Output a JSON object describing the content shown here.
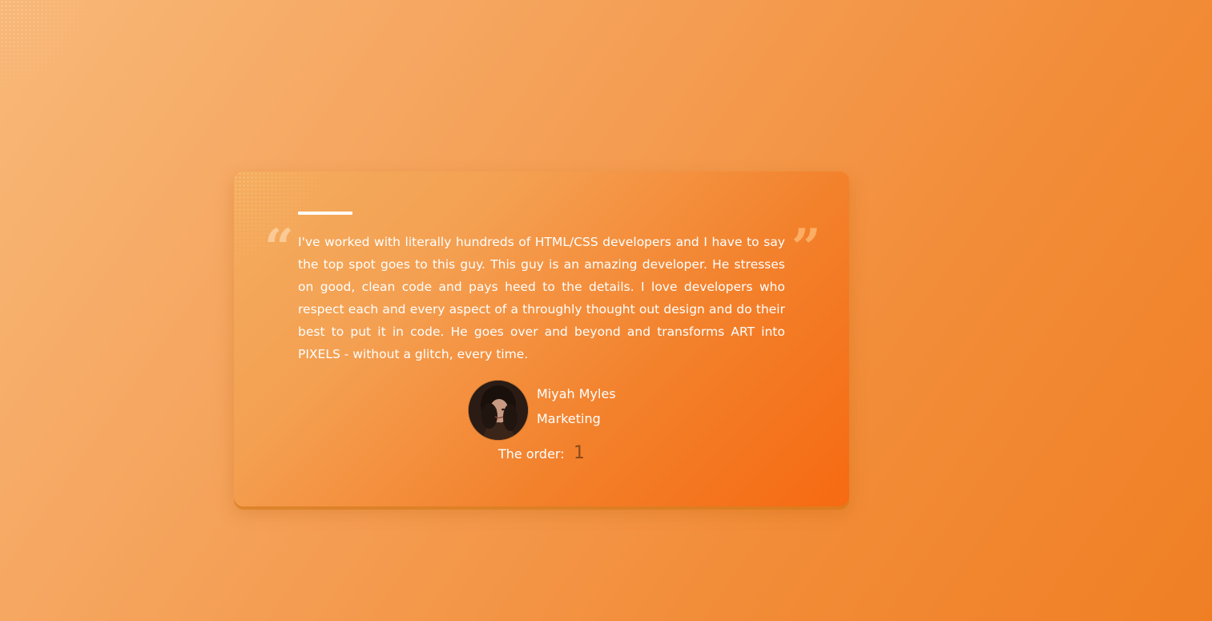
{
  "testimonial": {
    "quote": "I've worked with literally hundreds of HTML/CSS developers and I have to say the top spot goes to this guy. This guy is an amazing developer. He stresses on good, clean code and pays heed to the details. I love developers who respect each and every aspect of a throughly thought out design and do their best to put it in code. He goes over and beyond and transforms ART into PIXELS - without a glitch, every time.",
    "quote_open_glyph": "“",
    "quote_close_glyph": "”",
    "author": {
      "name": "Miyah Myles",
      "role": "Marketing"
    },
    "order": {
      "label": "The order:",
      "value": "1"
    }
  },
  "colors": {
    "background_start": "#f8b878",
    "background_end": "#f07f24",
    "card_start": "#f5ad5e",
    "card_end": "#f66a12",
    "text": "#ffffff",
    "order_value": "#8a4a1a"
  },
  "icons": {
    "quote_open": "quote-open-icon",
    "quote_close": "quote-close-icon"
  }
}
